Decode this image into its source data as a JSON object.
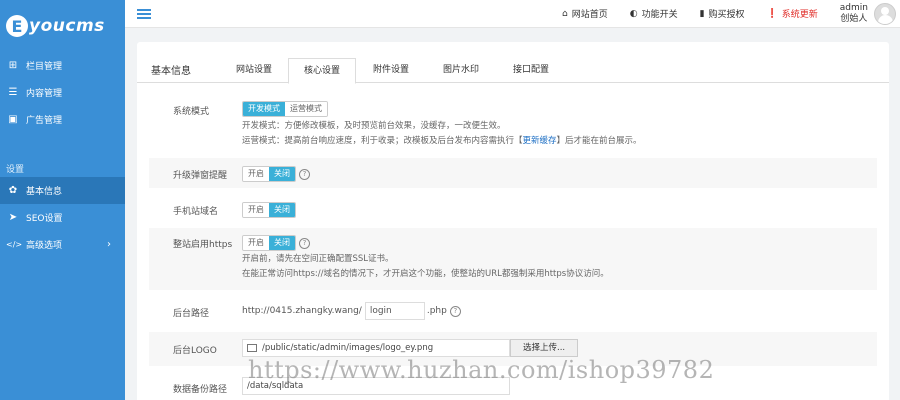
{
  "logo": {
    "mark": "E",
    "text": "youcms"
  },
  "sidebar": {
    "items": [
      {
        "icon": "sitemap-icon",
        "glyph": "⊞",
        "label": "栏目管理"
      },
      {
        "icon": "list-icon",
        "glyph": "☰",
        "label": "内容管理"
      },
      {
        "icon": "image-icon",
        "glyph": "▣",
        "label": "广告管理"
      }
    ],
    "section_label": "设置",
    "settings": [
      {
        "icon": "gear-icon",
        "glyph": "✿",
        "label": "基本信息",
        "active": true
      },
      {
        "icon": "send-icon",
        "glyph": "➤",
        "label": "SEO设置"
      },
      {
        "icon": "code-icon",
        "glyph": "</>",
        "label": "高级选项",
        "chevron": "›"
      }
    ]
  },
  "topbar": {
    "links": [
      {
        "icon": "home-icon",
        "glyph": "⌂",
        "label": "网站首页"
      },
      {
        "icon": "toggle-icon",
        "glyph": "◐",
        "label": "功能开关"
      },
      {
        "icon": "bookmark-icon",
        "glyph": "▮",
        "label": "购买授权"
      },
      {
        "icon": "alert-icon",
        "glyph": "❗",
        "label": "系统更新"
      }
    ],
    "user": {
      "name": "admin",
      "role": "创始人"
    }
  },
  "tabs": {
    "title": "基本信息",
    "items": [
      "网站设置",
      "核心设置",
      "附件设置",
      "图片水印",
      "接口配置"
    ],
    "active_index": 1
  },
  "settings": {
    "system_mode": {
      "label": "系统模式",
      "options": [
        "开发模式",
        "运营模式"
      ],
      "hint1": "开发模式：方便修改模板，及时预览前台效果，没缓存，一改便生效。",
      "hint2_pre": "运营模式：提高前台响应速度，利于收录；改模板及后台发布内容需执行【",
      "hint2_link": "更新缓存",
      "hint2_post": "】后才能在前台展示。"
    },
    "upgrade_popup": {
      "label": "升级弹窗提醒",
      "on": "开启",
      "off": "关闭"
    },
    "mobile_domain": {
      "label": "手机站域名",
      "on": "开启",
      "off": "关闭"
    },
    "https": {
      "label": "整站启用https",
      "on": "开启",
      "off": "关闭",
      "hint1": "开启前，请先在空间正确配置SSL证书。",
      "hint2": "在能正常访问https://域名的情况下，才开启这个功能，使整站的URL都强制采用https协议访问。"
    },
    "admin_path": {
      "label": "后台路径",
      "prefix": "http://0415.zhangky.wang/",
      "value": "login",
      "suffix": ".php"
    },
    "admin_logo": {
      "label": "后台LOGO",
      "path": "/public/static/admin/images/logo_ey.png",
      "button": "选择上传..."
    },
    "backup_path": {
      "label": "数据备份路径",
      "value": "/data/sqldata"
    }
  },
  "watermark": "https://www.huzhan.com/ishop39782",
  "colors": {
    "sidebar": "#3a8fd6",
    "accent": "#3ab0d8",
    "alert": "#e02b27",
    "link": "#1d6fc4"
  }
}
